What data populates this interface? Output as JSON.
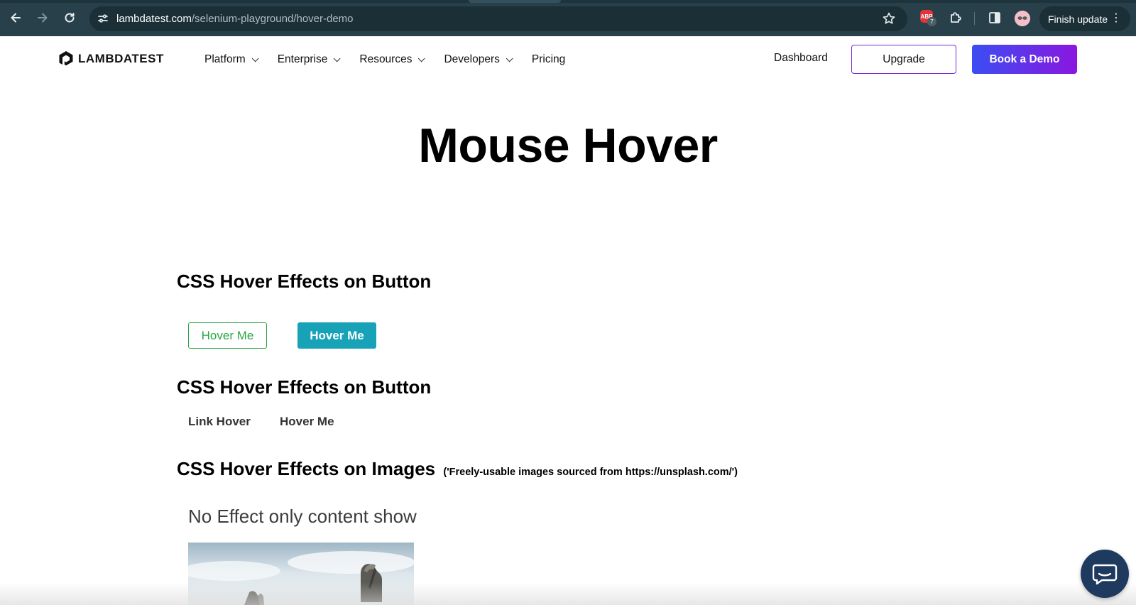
{
  "browser": {
    "url_domain": "lambdatest.com",
    "url_path": "/selenium-playground/hover-demo",
    "extension_badge_count": "7",
    "extension_abp_label": "ABP",
    "finish_update_label": "Finish update"
  },
  "header": {
    "logo_text": "LAMBDATEST",
    "menu": [
      {
        "label": "Platform",
        "has_dropdown": true
      },
      {
        "label": "Enterprise",
        "has_dropdown": true
      },
      {
        "label": "Resources",
        "has_dropdown": true
      },
      {
        "label": "Developers",
        "has_dropdown": true
      },
      {
        "label": "Pricing",
        "has_dropdown": false
      }
    ],
    "dashboard_label": "Dashboard",
    "upgrade_label": "Upgrade",
    "book_demo_label": "Book a Demo"
  },
  "main": {
    "title": "Mouse Hover",
    "section_buttons": {
      "title": "CSS Hover Effects on Button",
      "button_1_label": "Hover Me",
      "button_2_label": "Hover Me"
    },
    "section_links": {
      "title": "CSS Hover Effects on Button",
      "link_1_label": "Link Hover",
      "link_2_label": "Hover Me"
    },
    "section_images": {
      "title": "CSS Hover Effects on Images",
      "note": "('Freely-usable images sourced from https://unsplash.com/')",
      "caption": "No Effect only content show"
    }
  },
  "colors": {
    "chrome_bg": "#27404a",
    "brand_gradient_start": "#3a4ef2",
    "brand_gradient_end": "#8b16e0",
    "success_green": "#28a745",
    "info_teal": "#17a2b8",
    "chat_bg": "#1e3a5f"
  },
  "icons": {
    "back": "arrow-left-icon",
    "forward": "arrow-right-icon",
    "reload": "reload-icon",
    "site_info": "tune-icon",
    "bookmark": "star-icon",
    "extensions": "puzzle-icon",
    "side_panel": "side-panel-icon",
    "menu": "kebab-menu-icon",
    "chat": "chat-bubble-icon"
  }
}
